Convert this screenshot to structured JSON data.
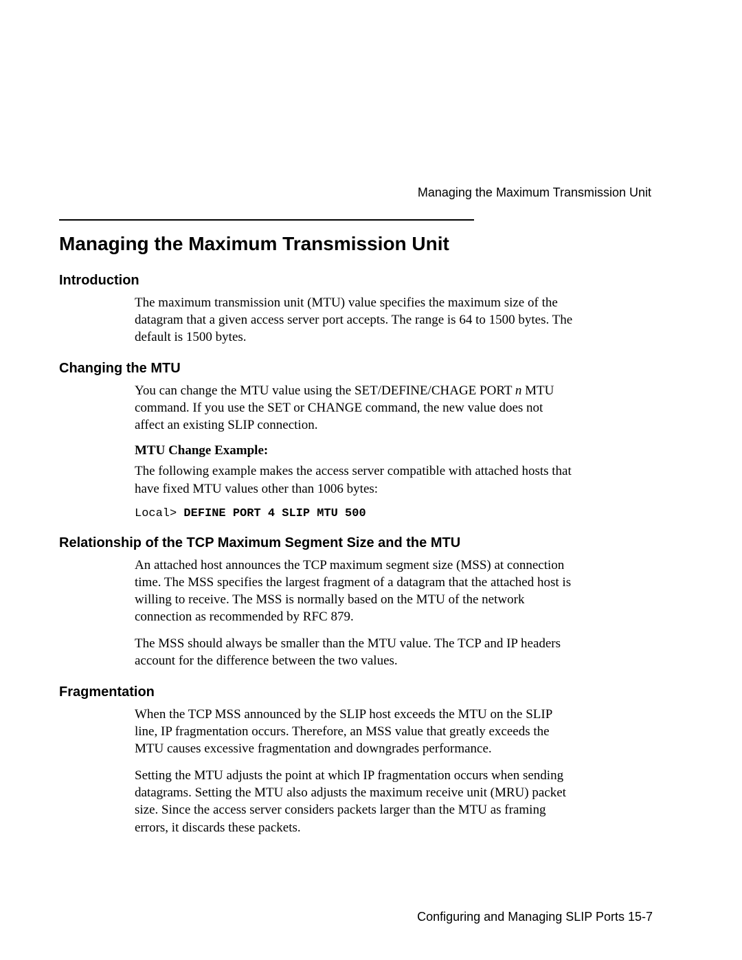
{
  "running_header": "Managing the Maximum Transmission Unit",
  "title": "Managing the Maximum Transmission Unit",
  "sections": {
    "intro": {
      "heading": "Introduction",
      "p1": "The maximum transmission unit (MTU) value specifies the maximum size of the datagram that a given access server port accepts. The range is 64 to 1500 bytes. The default is 1500 bytes."
    },
    "changing": {
      "heading": "Changing the MTU",
      "p1_pre": "You can change the MTU value using the SET/DEFINE/CHAGE PORT ",
      "p1_it": "n",
      "p1_post": " MTU command. If you use the SET or CHANGE command, the new value does not affect an existing SLIP connection.",
      "subhead": "MTU Change Example:",
      "p2": "The following example makes the access server compatible with attached hosts that have fixed MTU values other than 1006 bytes:",
      "code_prefix": "Local> ",
      "code_cmd": "DEFINE PORT 4 SLIP MTU 500"
    },
    "relationship": {
      "heading": "Relationship of the TCP Maximum Segment Size and the MTU",
      "p1": "An attached host announces the TCP maximum segment size (MSS) at connection time. The MSS specifies the largest fragment of a datagram that the attached host is willing to receive. The MSS is normally based on the MTU of the network connection as recommended by RFC 879.",
      "p2": "The MSS should always be smaller than the MTU value. The TCP and IP headers account for the difference between the two values."
    },
    "fragmentation": {
      "heading": "Fragmentation",
      "p1": "When the TCP MSS announced by the SLIP host exceeds the MTU on the SLIP line, IP fragmentation occurs. Therefore, an MSS value that greatly exceeds the MTU causes excessive fragmentation and downgrades performance.",
      "p2": "Setting the MTU adjusts the point at which IP fragmentation occurs when sending datagrams. Setting the MTU also adjusts the maximum receive unit (MRU) packet size. Since the access server considers packets larger than the MTU as framing errors, it discards these packets."
    }
  },
  "footer": "Configuring and Managing SLIP Ports 15-7"
}
